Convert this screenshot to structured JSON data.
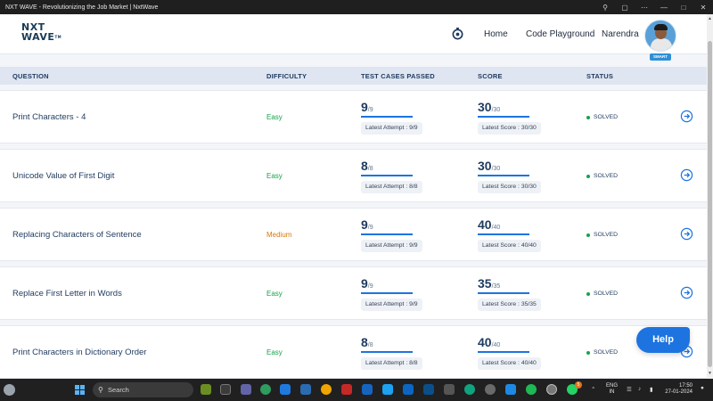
{
  "window": {
    "title": "NXT WAVE - Revolutionizing the Job Market | NxtWave"
  },
  "header": {
    "logo_line1": "NXT",
    "logo_line2": "WAVE",
    "logo_tm": "TM",
    "nav_home": "Home",
    "nav_code": "Code Playground",
    "user_name": "Narendra",
    "avatar_badge": "SMART"
  },
  "table": {
    "columns": [
      "QUESTION",
      "DIFFICULTY",
      "TEST CASES PASSED",
      "SCORE",
      "STATUS"
    ],
    "rows": [
      {
        "question": "Print Characters - 4",
        "difficulty": "Easy",
        "tc_passed": "9",
        "tc_total": "/9",
        "tc_fraction": 1.0,
        "attempt": "Latest Attempt : 9/9",
        "score": "30",
        "score_total": "/30",
        "score_fraction": 1.0,
        "latest_score": "Latest Score : 30/30",
        "status": "SOLVED"
      },
      {
        "question": "Unicode Value of First Digit",
        "difficulty": "Easy",
        "tc_passed": "8",
        "tc_total": "/8",
        "tc_fraction": 1.0,
        "attempt": "Latest Attempt : 8/8",
        "score": "30",
        "score_total": "/30",
        "score_fraction": 1.0,
        "latest_score": "Latest Score : 30/30",
        "status": "SOLVED"
      },
      {
        "question": "Replacing Characters of Sentence",
        "difficulty": "Medium",
        "tc_passed": "9",
        "tc_total": "/9",
        "tc_fraction": 1.0,
        "attempt": "Latest Attempt : 9/9",
        "score": "40",
        "score_total": "/40",
        "score_fraction": 1.0,
        "latest_score": "Latest Score : 40/40",
        "status": "SOLVED"
      },
      {
        "question": "Replace First Letter in Words",
        "difficulty": "Easy",
        "tc_passed": "9",
        "tc_total": "/9",
        "tc_fraction": 1.0,
        "attempt": "Latest Attempt : 9/9",
        "score": "35",
        "score_total": "/35",
        "score_fraction": 1.0,
        "latest_score": "Latest Score : 35/35",
        "status": "SOLVED"
      },
      {
        "question": "Print Characters in Dictionary Order",
        "difficulty": "Easy",
        "tc_passed": "8",
        "tc_total": "/8",
        "tc_fraction": 1.0,
        "attempt": "Latest Attempt : 8/8",
        "score": "40",
        "score_total": "/40",
        "score_fraction": 1.0,
        "latest_score": "Latest Score : 40/40",
        "status": "SOLVED"
      }
    ]
  },
  "help_label": "Help",
  "taskbar": {
    "search_placeholder": "Search",
    "lang_line1": "ENG",
    "lang_line2": "IN",
    "time": "17:50",
    "date": "27-01-2024",
    "badge_count": "5"
  },
  "colors": {
    "accent": "#1d74e0",
    "easy": "#16a34a",
    "medium": "#d97706",
    "heading": "#1e3a5f"
  },
  "icons": [
    "search-icon",
    "tab-search-icon",
    "minimize-icon",
    "maximize-icon",
    "close-icon",
    "stopwatch-icon",
    "arrow-circle-right-icon",
    "windows-start-icon",
    "wifi-icon",
    "volume-icon",
    "battery-icon",
    "chevron-up-icon"
  ]
}
